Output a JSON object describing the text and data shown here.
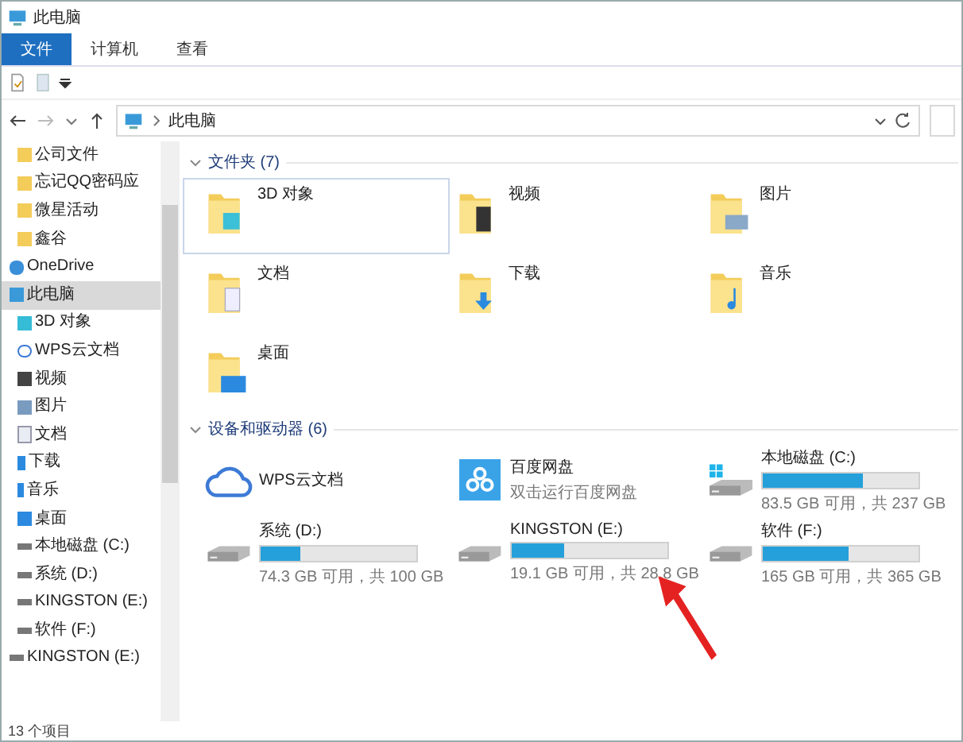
{
  "window": {
    "title": "此电脑"
  },
  "ribbon_tabs": [
    {
      "label": "文件",
      "selected": true
    },
    {
      "label": "计算机",
      "selected": false
    },
    {
      "label": "查看",
      "selected": false
    }
  ],
  "address": {
    "path": "此电脑"
  },
  "sidebar": {
    "items": [
      {
        "label": "公司文件",
        "kind": "folder"
      },
      {
        "label": "忘记QQ密码应",
        "kind": "folder"
      },
      {
        "label": "微星活动",
        "kind": "folder"
      },
      {
        "label": "鑫谷",
        "kind": "folder"
      },
      {
        "label": "OneDrive",
        "kind": "cloud"
      },
      {
        "label": "此电脑",
        "kind": "pc",
        "selected": true,
        "children": [
          {
            "label": "3D 对象",
            "kind": "cube"
          },
          {
            "label": "WPS云文档",
            "kind": "wps"
          },
          {
            "label": "视频",
            "kind": "video"
          },
          {
            "label": "图片",
            "kind": "picture"
          },
          {
            "label": "文档",
            "kind": "doc"
          },
          {
            "label": "下载",
            "kind": "download"
          },
          {
            "label": "音乐",
            "kind": "music"
          },
          {
            "label": "桌面",
            "kind": "desktop"
          },
          {
            "label": "本地磁盘 (C:)",
            "kind": "drive"
          },
          {
            "label": "系统 (D:)",
            "kind": "drive"
          },
          {
            "label": "KINGSTON (E:)",
            "kind": "drive"
          },
          {
            "label": "软件 (F:)",
            "kind": "drive"
          }
        ]
      },
      {
        "label": "KINGSTON (E:)",
        "kind": "drive"
      }
    ]
  },
  "folders": {
    "heading": "文件夹 (7)",
    "items": [
      {
        "name": "3D 对象",
        "kind": "cube",
        "selected": true
      },
      {
        "name": "视频",
        "kind": "video",
        "selected": false
      },
      {
        "name": "图片",
        "kind": "picture",
        "selected": false
      },
      {
        "name": "文档",
        "kind": "doc",
        "selected": false
      },
      {
        "name": "下载",
        "kind": "download",
        "selected": false
      },
      {
        "name": "音乐",
        "kind": "music",
        "selected": false
      },
      {
        "name": "桌面",
        "kind": "desktop",
        "selected": false
      }
    ]
  },
  "devices": {
    "heading": "设备和驱动器 (6)",
    "items": [
      {
        "name": "WPS云文档",
        "kind": "wps"
      },
      {
        "name": "百度网盘",
        "kind": "baidu",
        "subtitle": "双击运行百度网盘"
      },
      {
        "name": "本地磁盘 (C:)",
        "kind": "system-drive",
        "level": 0.64,
        "reading": "83.5 GB 可用，共 237 GB"
      },
      {
        "name": "系统 (D:)",
        "kind": "drive",
        "level": 0.26,
        "reading": "74.3 GB 可用，共 100 GB"
      },
      {
        "name": "KINGSTON (E:)",
        "kind": "drive",
        "level": 0.34,
        "reading": "19.1 GB 可用，共 28.8 GB"
      },
      {
        "name": "软件 (F:)",
        "kind": "drive",
        "level": 0.55,
        "reading": "165 GB 可用，共 365 GB"
      }
    ]
  },
  "status_bar": {
    "count": "13 个项目"
  }
}
